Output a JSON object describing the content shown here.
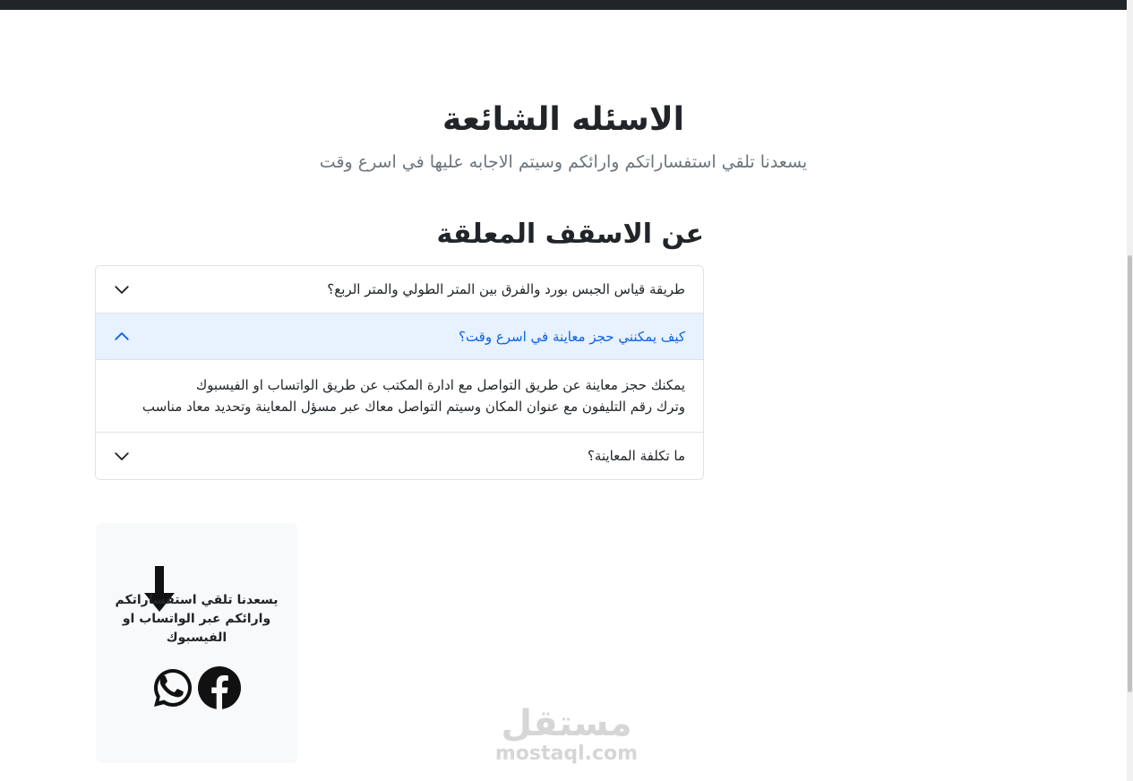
{
  "page": {
    "title": "الاسئله الشائعة",
    "subtitle": "يسعدنا تلقي استفساراتكم وارائكم وسيتم الاجابه عليها في اسرع وقت"
  },
  "section": {
    "heading": "عن الاسقف المعلقة"
  },
  "faq": [
    {
      "question": "طريقة قياس الجبس بورد والفرق بين المتر الطولي والمتر الربع؟",
      "expanded": false
    },
    {
      "question": "كيف يمكنني حجز معاينة في اسرع وقت؟",
      "expanded": true,
      "answer_lines": [
        "يمكنك حجز معاينة عن طريق التواصل مع ادارة المكتب عن طريق الواتساب او الفيسبوك",
        "وترك رقم التليفون مع عنوان المكان وسيتم التواصل معاك عبر مسؤل المعاينة وتحديد معاد مناسب"
      ]
    },
    {
      "question": "ما تكلفة المعاينة؟",
      "expanded": false
    }
  ],
  "contact_card": {
    "text": "يسعدنا تلقي استفساراتكم وارائكم عبر الواتساب او الفيسبوك",
    "icons": [
      "arrow-down-icon",
      "whatsapp-icon",
      "facebook-icon"
    ]
  },
  "watermark": {
    "arabic": "مستقل",
    "latin": "mostaql.com"
  },
  "colors": {
    "topbar": "#212529",
    "active_header_bg": "#e7f1ff",
    "active_header_text": "#0c63e4",
    "muted_text": "#6c757d",
    "card_bg": "#f8f9fa"
  }
}
